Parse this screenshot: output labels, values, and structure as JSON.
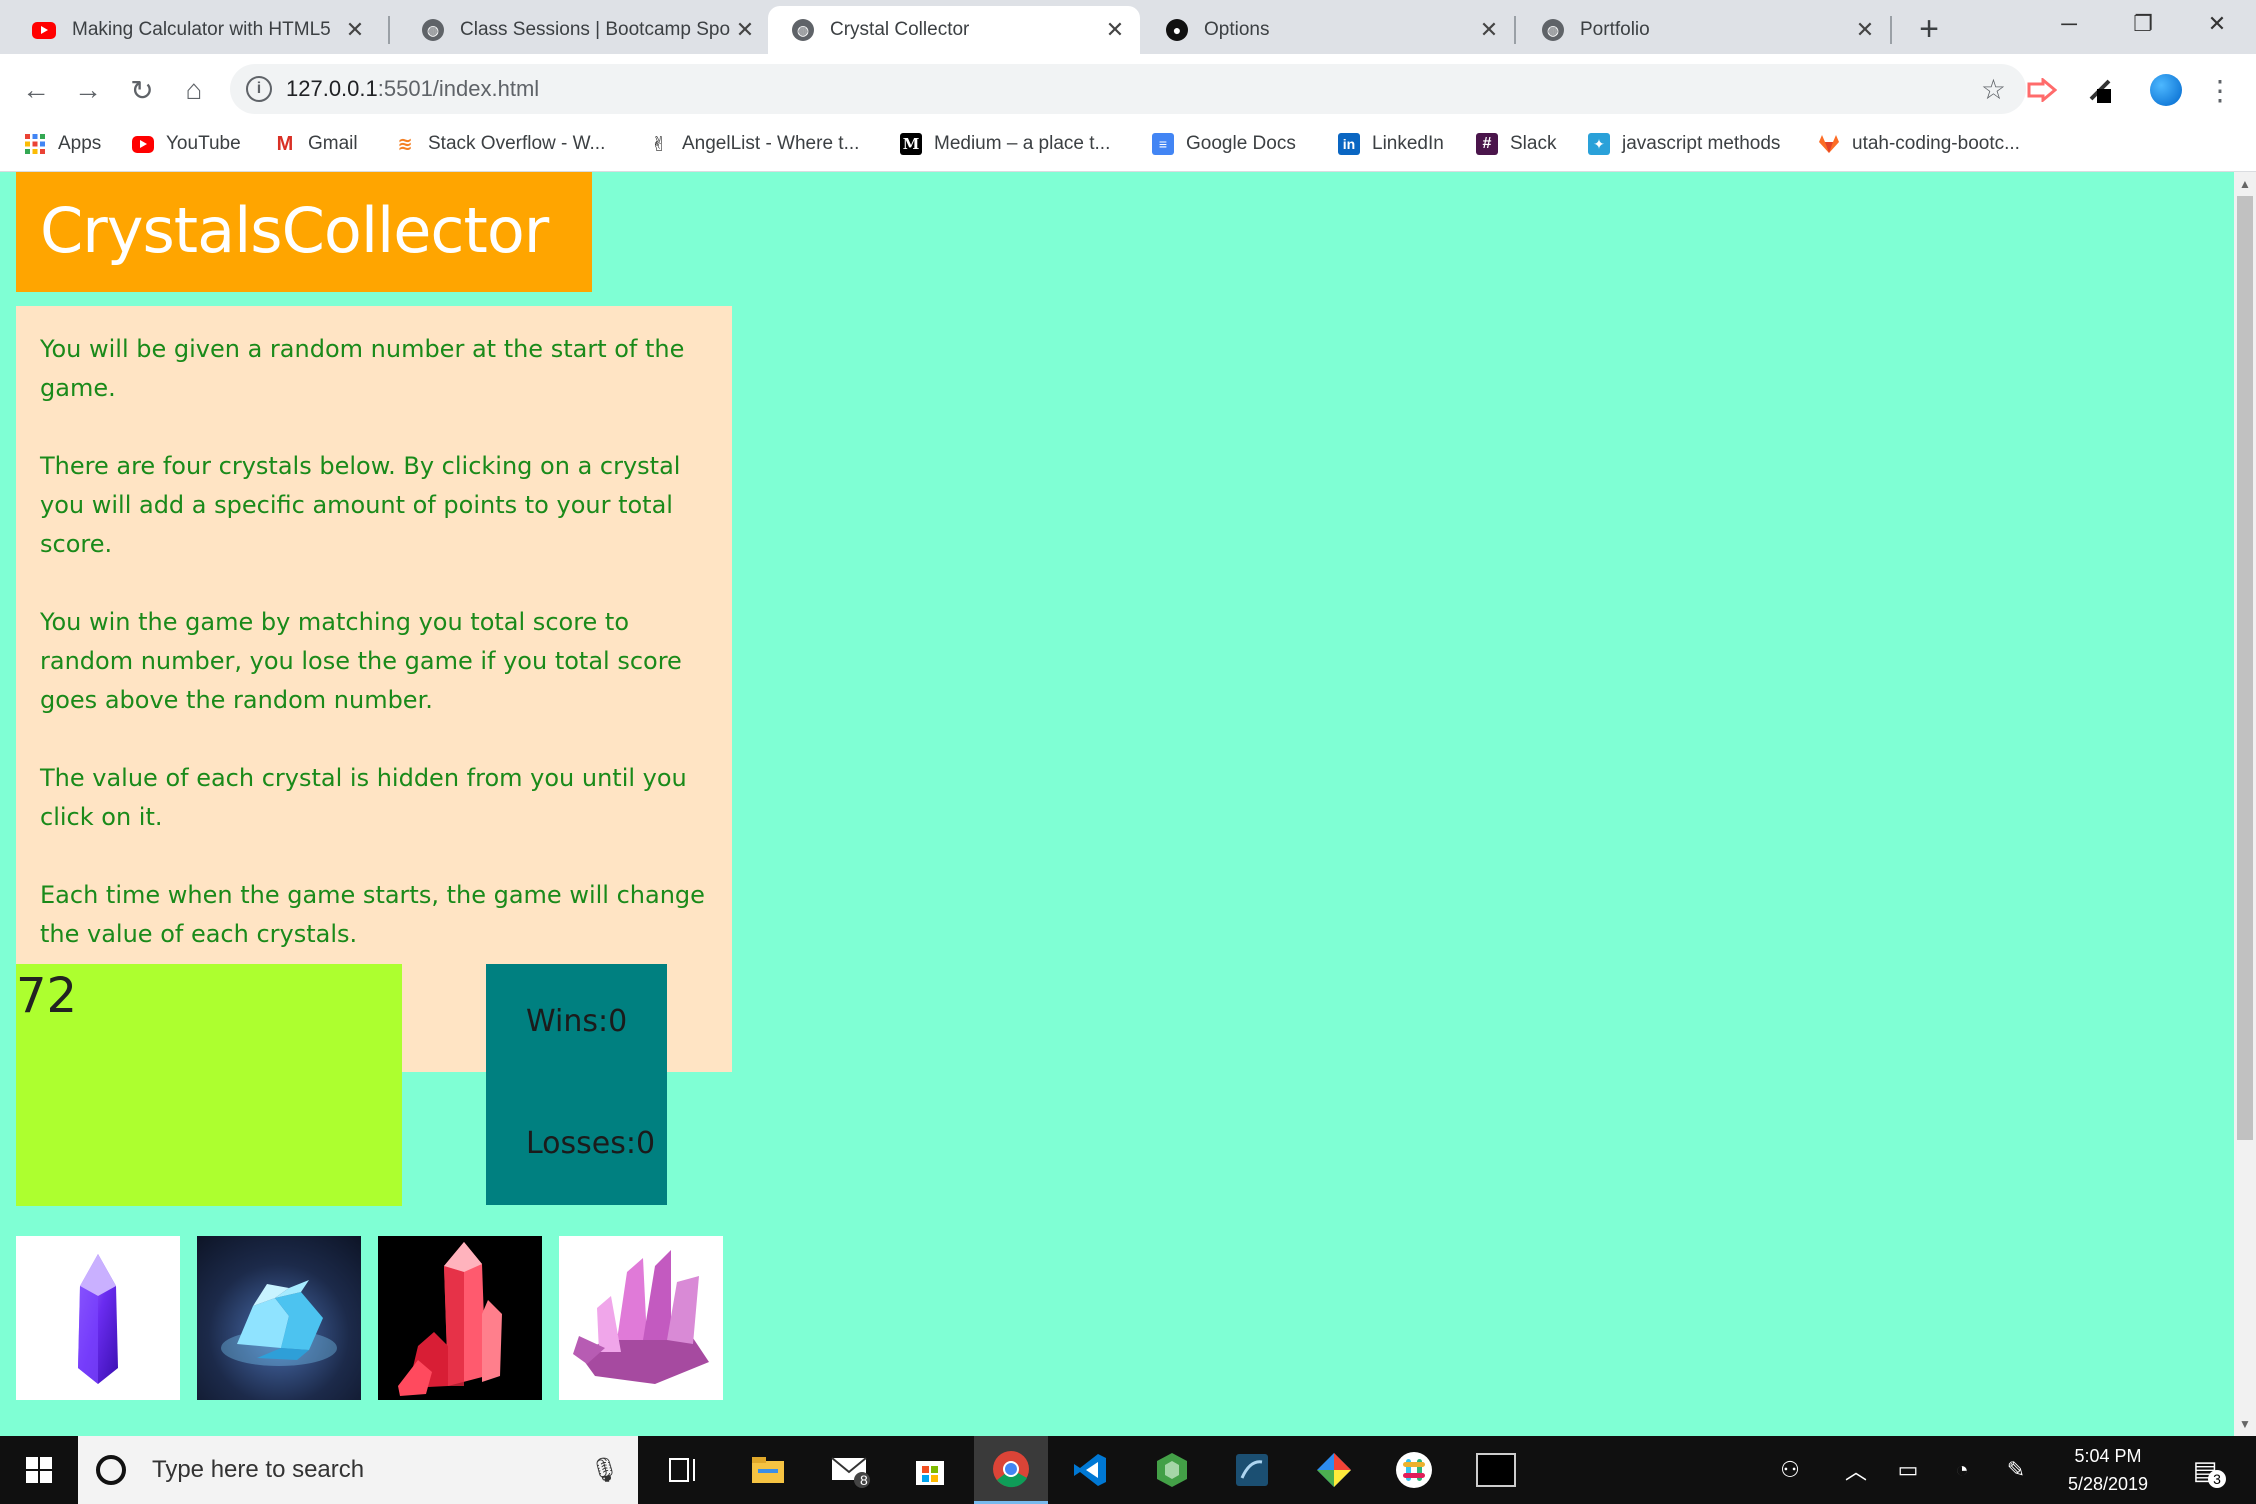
{
  "browser": {
    "tabs": [
      {
        "title": "Making Calculator with HTML5",
        "icon": "youtube-icon"
      },
      {
        "title": "Class Sessions | Bootcamp Spot",
        "icon": "globe-icon"
      },
      {
        "title": "Crystal Collector",
        "icon": "globe-icon",
        "active": true
      },
      {
        "title": "Options",
        "icon": "github-icon"
      },
      {
        "title": "Portfolio",
        "icon": "globe-icon"
      }
    ],
    "url_host": "127.0.0.1",
    "url_rest": ":5501/index.html",
    "bookmarks": [
      {
        "label": "Apps",
        "icon": "apps-grid-icon"
      },
      {
        "label": "YouTube",
        "icon": "youtube-icon"
      },
      {
        "label": "Gmail",
        "icon": "gmail-icon"
      },
      {
        "label": "Stack Overflow - W...",
        "icon": "stackoverflow-icon"
      },
      {
        "label": "AngelList - Where t...",
        "icon": "angellist-icon"
      },
      {
        "label": "Medium – a place t...",
        "icon": "medium-icon"
      },
      {
        "label": "Google Docs",
        "icon": "google-docs-icon"
      },
      {
        "label": "LinkedIn",
        "icon": "linkedin-icon"
      },
      {
        "label": "Slack",
        "icon": "slack-icon"
      },
      {
        "label": "javascript methods",
        "icon": "bookmark-site-icon"
      },
      {
        "label": "utah-coding-bootc...",
        "icon": "gitlab-icon"
      }
    ]
  },
  "page": {
    "title": "CrystalsCollector",
    "instructions": [
      "You will be given a random number at the start of the game.",
      "There are four crystals below. By clicking on a crystal you will add a specific amount of points to your total score.",
      "You win the game by matching you total score to random number, you lose the game if you total score goes above the random number.",
      "The value of each crystal is hidden from you until you click on it.",
      "Each time when the game starts, the game will change the value of each crystals."
    ],
    "random_number": "72",
    "wins": "Wins:0",
    "losses": "Losses:0",
    "crystals": [
      "purple-crystal",
      "blue-crystal",
      "red-crystal",
      "pink-crystal"
    ],
    "colors": {
      "background": "#7fffd4",
      "header": "#ffa500",
      "instructions_bg": "#ffe4c4",
      "instructions_text": "#1a8a1a",
      "target_box": "#adff2f",
      "score_box": "#008080"
    }
  },
  "taskbar": {
    "search_placeholder": "Type here to search",
    "time": "5:04 PM",
    "date": "5/28/2019",
    "mail_badge": "8",
    "notification_badge": "3"
  }
}
